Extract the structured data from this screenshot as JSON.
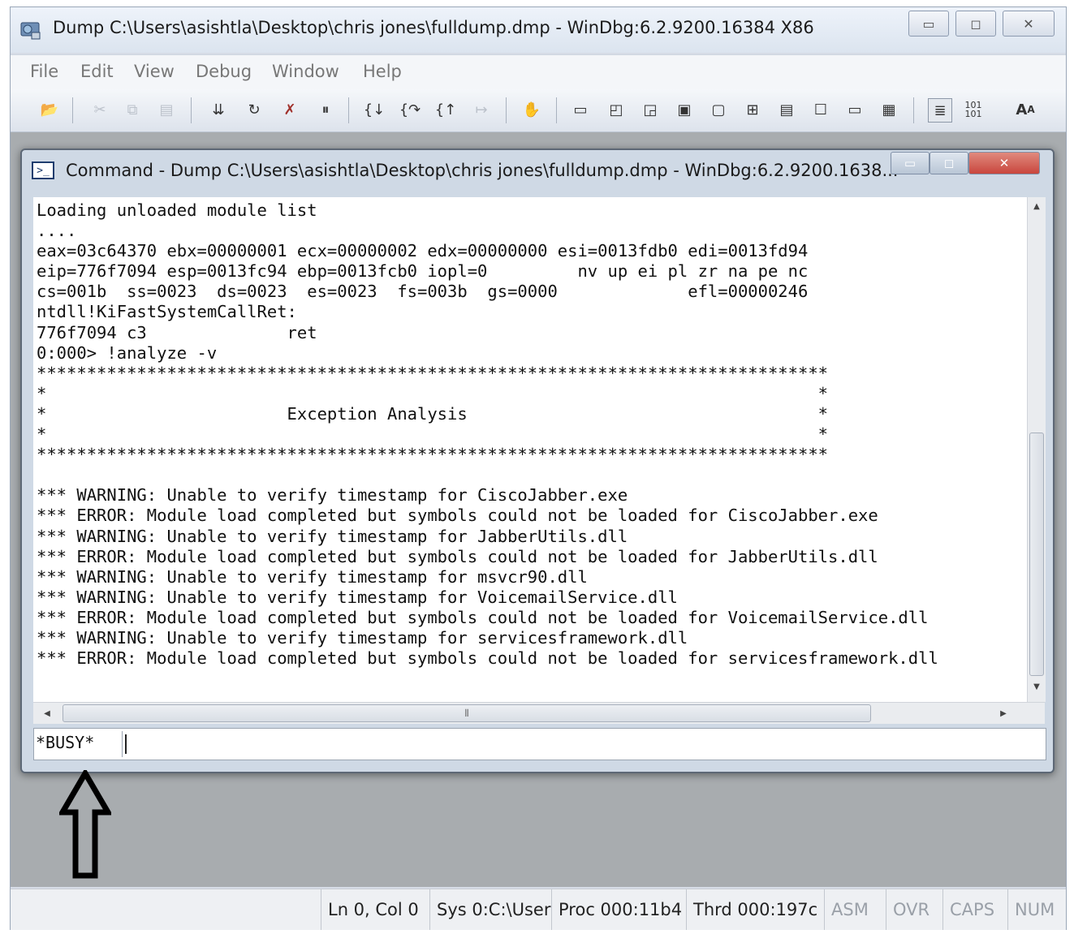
{
  "window": {
    "title": "Dump C:\\Users\\asishtla\\Desktop\\chris jones\\fulldump.dmp - WinDbg:6.2.9200.16384 X86",
    "minimize": "▭",
    "maximize": "◻",
    "close": "✕"
  },
  "menu": [
    "File",
    "Edit",
    "View",
    "Debug",
    "Window",
    "Help"
  ],
  "command_window": {
    "title": "Command - Dump C:\\Users\\asishtla\\Desktop\\chris jones\\fulldump.dmp - WinDbg:6.2.9200.1638...",
    "minimize": "▭",
    "maximize": "◻",
    "close": "✕",
    "output": "Loading unloaded module list\n....\neax=03c64370 ebx=00000001 ecx=00000002 edx=00000000 esi=0013fdb0 edi=0013fd94\neip=776f7094 esp=0013fc94 ebp=0013fcb0 iopl=0         nv up ei pl zr na pe nc\ncs=001b  ss=0023  ds=0023  es=0023  fs=003b  gs=0000             efl=00000246\nntdll!KiFastSystemCallRet:\n776f7094 c3              ret\n0:000> !analyze -v\n*******************************************************************************\n*                                                                             *\n*                        Exception Analysis                                   *\n*                                                                             *\n*******************************************************************************\n\n*** WARNING: Unable to verify timestamp for CiscoJabber.exe\n*** ERROR: Module load completed but symbols could not be loaded for CiscoJabber.exe\n*** WARNING: Unable to verify timestamp for JabberUtils.dll\n*** ERROR: Module load completed but symbols could not be loaded for JabberUtils.dll\n*** WARNING: Unable to verify timestamp for msvcr90.dll\n*** WARNING: Unable to verify timestamp for VoicemailService.dll\n*** ERROR: Module load completed but symbols could not be loaded for VoicemailService.dll\n*** WARNING: Unable to verify timestamp for servicesframework.dll\n*** ERROR: Module load completed but symbols could not be loaded for servicesframework.dll",
    "prompt": "*BUSY*",
    "input_value": ""
  },
  "statusbar": {
    "position": "Ln 0, Col 0",
    "sys": "Sys 0:C:\\User",
    "proc": "Proc 000:11b4",
    "thrd": "Thrd 000:197c",
    "asm": "ASM",
    "ovr": "OVR",
    "caps": "CAPS",
    "num": "NUM"
  },
  "colors": {
    "close_button": "#c9463d",
    "mdi_background": "#a8acaf"
  }
}
